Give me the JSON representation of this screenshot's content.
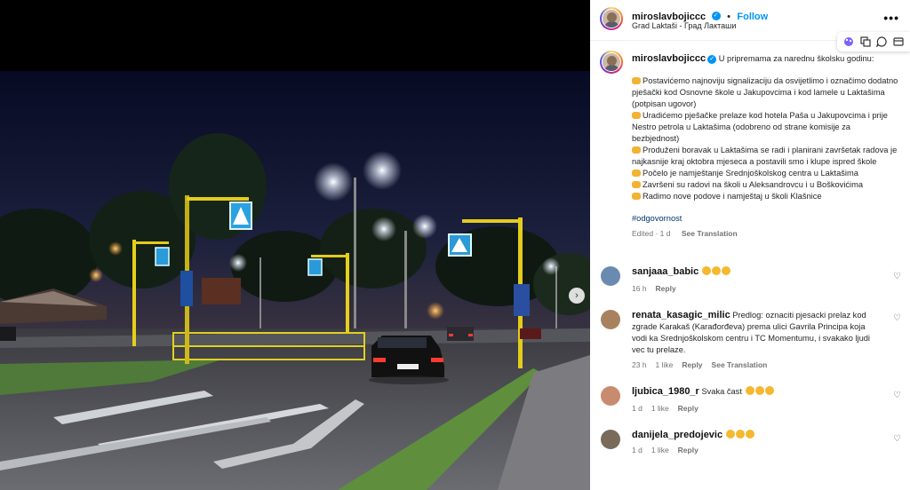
{
  "post": {
    "username": "miroslavbojiccc",
    "follow_label": "Follow",
    "location": "Grad Laktaši - Град Лакташи",
    "more_icon": "more-horizontal-icon",
    "verified_icon": "verified-badge-icon",
    "caption_intro": "U pripremama za narednu školsku godinu:",
    "caption_items": [
      "Postavićemo najnoviju signalizaciju da osvijetlimo i označimo dodatno pješački kod Osnovne škole u Jakupovcima i kod lamele u Laktašima (potpisan ugovor)",
      "Uradićemo pješačke prelaze kod hotela Paša u Jakupovcima i prije Nestro petrola u Laktašima (odobreno od strane komisije za bezbjednost)",
      "Produženi boravak u Laktašima se radi i planirani završetak radova je najkasnije kraj oktobra mjeseca a postavili smo i klupe ispred škole",
      "Počelo je namještanje Srednjoškolskog centra u Laktašima",
      "Završeni su radovi na školi u Aleksandrovcu i u Boškovićima",
      "Radimo nove podove i namještaj u školi Klašnice"
    ],
    "hashtag": "#odgovornost",
    "edited": "Edited · 1 d",
    "see_translation": "See Translation"
  },
  "toolbar": {
    "icons": [
      "palette-icon",
      "copy-icon",
      "comment-icon",
      "card-icon"
    ]
  },
  "comments": [
    {
      "username": "sanjaaa_babic",
      "text": "",
      "claps": 3,
      "time": "16 h",
      "likes": "",
      "reply": "Reply",
      "see_translation": ""
    },
    {
      "username": "renata_kasagic_milic",
      "text": "Predlog: oznaciti pjesacki prelaz kod zgrade Karakaš (Karađorđeva) prema ulici Gavrila Principa koja vodi ka Srednjoškolskom centru i TC Momentumu, i svakako ljudi vec tu prelaze.",
      "claps": 0,
      "time": "23 h",
      "likes": "1 like",
      "reply": "Reply",
      "see_translation": "See Translation"
    },
    {
      "username": "ljubica_1980_r",
      "text": "Svaka čast",
      "claps": 3,
      "time": "1 d",
      "likes": "1 like",
      "reply": "Reply",
      "see_translation": ""
    },
    {
      "username": "danijela_predojevic",
      "text": "",
      "claps": 3,
      "time": "1 d",
      "likes": "1 like",
      "reply": "Reply",
      "see_translation": ""
    }
  ],
  "photo": {
    "next_icon": "chevron-right-icon",
    "sign_icon": "pedestrian-crossing-sign-icon",
    "accent": "#0095f6"
  }
}
